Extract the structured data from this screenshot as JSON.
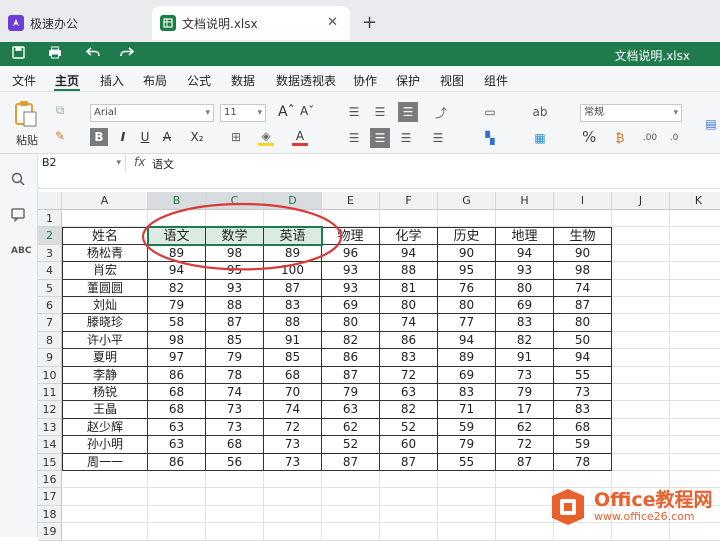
{
  "tabs": [
    {
      "label": "极速办公"
    },
    {
      "label": "文档说明.xlsx"
    }
  ],
  "quickbar": {
    "title": "文档说明.xlsx"
  },
  "menu": [
    "文件",
    "主页",
    "插入",
    "布局",
    "公式",
    "数据",
    "数据透视表",
    "协作",
    "保护",
    "视图",
    "组件"
  ],
  "ribbon": {
    "paste": "粘贴",
    "font": "Arial",
    "size": "11",
    "numfmt": "常规",
    "pct": "%",
    "bold": "B",
    "italic": "I",
    "underline": "U",
    "strike": "A",
    "sub": "X₂"
  },
  "formula": {
    "cellref": "B2",
    "fx": "fx",
    "value": "语文"
  },
  "columns": [
    "A",
    "B",
    "C",
    "D",
    "E",
    "F",
    "G",
    "H",
    "I",
    "J",
    "K"
  ],
  "rows": [
    "1",
    "2",
    "3",
    "4",
    "5",
    "6",
    "7",
    "8",
    "9",
    "10",
    "11",
    "12",
    "13",
    "14",
    "15",
    "16",
    "17",
    "18",
    "19"
  ],
  "table": {
    "header": [
      "姓名",
      "语文",
      "数学",
      "英语",
      "物理",
      "化学",
      "历史",
      "地理",
      "生物"
    ],
    "rows": [
      [
        "杨松青",
        "89",
        "98",
        "89",
        "96",
        "94",
        "90",
        "94",
        "90"
      ],
      [
        "肖宏",
        "94",
        "95",
        "100",
        "93",
        "88",
        "95",
        "93",
        "98"
      ],
      [
        "董圆圆",
        "82",
        "93",
        "87",
        "93",
        "81",
        "76",
        "80",
        "74"
      ],
      [
        "刘灿",
        "79",
        "88",
        "83",
        "69",
        "80",
        "80",
        "69",
        "87"
      ],
      [
        "滕晓珍",
        "58",
        "87",
        "88",
        "80",
        "74",
        "77",
        "83",
        "80"
      ],
      [
        "许小平",
        "98",
        "85",
        "91",
        "82",
        "86",
        "94",
        "82",
        "50"
      ],
      [
        "夏明",
        "97",
        "79",
        "85",
        "86",
        "83",
        "89",
        "91",
        "94"
      ],
      [
        "李静",
        "86",
        "78",
        "68",
        "87",
        "72",
        "69",
        "73",
        "55"
      ],
      [
        "杨锐",
        "68",
        "74",
        "70",
        "79",
        "63",
        "83",
        "79",
        "73"
      ],
      [
        "王晶",
        "68",
        "73",
        "74",
        "63",
        "82",
        "71",
        "17",
        "83"
      ],
      [
        "赵少辉",
        "63",
        "73",
        "72",
        "62",
        "52",
        "59",
        "62",
        "68"
      ],
      [
        "孙小明",
        "63",
        "68",
        "73",
        "52",
        "60",
        "79",
        "72",
        "59"
      ],
      [
        "周一一",
        "86",
        "56",
        "73",
        "87",
        "87",
        "55",
        "87",
        "78"
      ]
    ]
  },
  "watermark": {
    "line1": "Office教程网",
    "line2": "www.office26.com"
  },
  "colors": {
    "accent": "#1f7a4c",
    "annotation": "#d93a3a",
    "watermark": "#e8602c"
  }
}
